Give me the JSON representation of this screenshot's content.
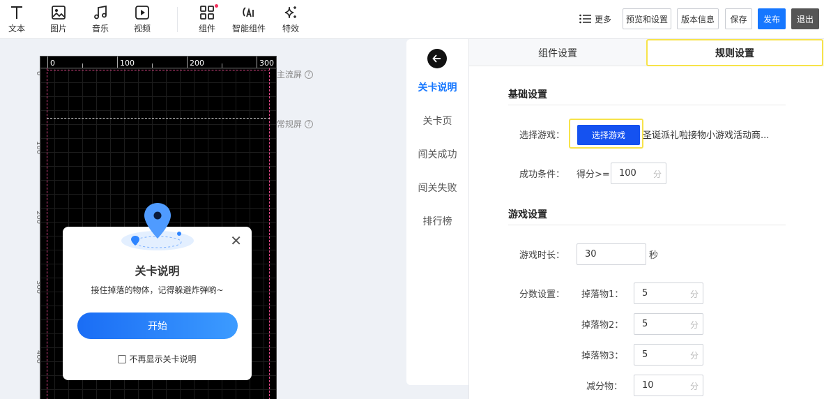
{
  "toolbar": {
    "tools": [
      {
        "label": "文本",
        "icon": "text-icon"
      },
      {
        "label": "图片",
        "icon": "image-icon"
      },
      {
        "label": "音乐",
        "icon": "music-icon"
      },
      {
        "label": "视频",
        "icon": "video-icon"
      },
      {
        "label": "组件",
        "icon": "components-icon"
      },
      {
        "label": "智能组件",
        "icon": "ai-icon"
      },
      {
        "label": "特效",
        "icon": "sparkle-icon"
      }
    ],
    "more_label": "更多",
    "preview_label": "预览和设置",
    "version_label": "版本信息",
    "save_label": "保存",
    "publish_label": "发布",
    "exit_label": "退出",
    "accent_color": "#1677ff",
    "notice_dot_color": "#f5315e"
  },
  "canvas": {
    "ruler_top_labels": [
      "0",
      "100",
      "200",
      "300"
    ],
    "ruler_left_labels": [
      "0",
      "100",
      "200",
      "300",
      "400"
    ],
    "main_screen_label": "主流屏",
    "normal_screen_label": "常规屏",
    "help_glyph": "?"
  },
  "popup": {
    "title": "关卡说明",
    "description": "接住掉落的物体，记得躲避炸弹哟~",
    "start_label": "开始",
    "dont_show_label": "不再显示关卡说明",
    "close_glyph": "✕"
  },
  "nav": {
    "items": [
      {
        "label": "关卡说明",
        "active": true
      },
      {
        "label": "关卡页",
        "active": false
      },
      {
        "label": "闯关成功",
        "active": false
      },
      {
        "label": "闯关失败",
        "active": false
      },
      {
        "label": "排行榜",
        "active": false
      }
    ]
  },
  "panel": {
    "tabs": [
      "组件设置",
      "规则设置"
    ],
    "active_tab": "规则设置",
    "basic": {
      "title": "基础设置",
      "select_game_label": "选择游戏：",
      "select_game_button": "选择游戏",
      "game_name": "圣诞派礼啦接物小游戏活动商...",
      "success_label": "成功条件：",
      "success_prefix": "得分>=",
      "success_value": "100",
      "success_unit": "分"
    },
    "game": {
      "title": "游戏设置",
      "duration_label": "游戏时长：",
      "duration_value": "30",
      "duration_unit": "秒",
      "score_label": "分数设置：",
      "score_items": [
        {
          "label": "掉落物1：",
          "value": "5",
          "unit": "分"
        },
        {
          "label": "掉落物2：",
          "value": "5",
          "unit": "分"
        },
        {
          "label": "掉落物3：",
          "value": "5",
          "unit": "分"
        },
        {
          "label": "减分物：",
          "value": "10",
          "unit": "分"
        }
      ]
    }
  }
}
